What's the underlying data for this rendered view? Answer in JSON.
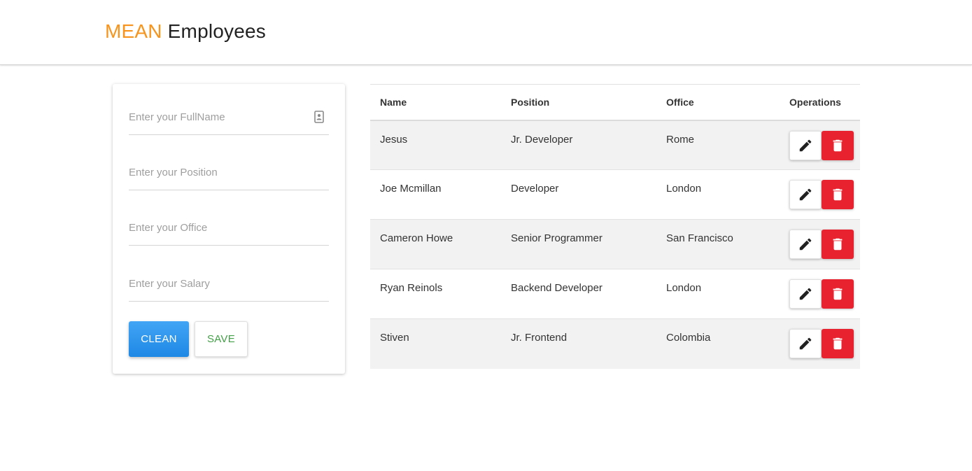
{
  "header": {
    "brand_accent": "MEAN",
    "brand_rest": " Employees"
  },
  "form": {
    "fullname": {
      "placeholder": "Enter your FullName",
      "value": "",
      "icon": "contact-card-icon"
    },
    "position": {
      "placeholder": "Enter your Position",
      "value": ""
    },
    "office": {
      "placeholder": "Enter your Office",
      "value": ""
    },
    "salary": {
      "placeholder": "Enter your Salary",
      "value": ""
    },
    "clean_label": "Clean",
    "save_label": "Save"
  },
  "table": {
    "columns": [
      "Name",
      "Position",
      "Office",
      "Operations"
    ],
    "rows": [
      {
        "name": "Jesus",
        "position": "Jr. Developer",
        "office": "Rome"
      },
      {
        "name": "Joe Mcmillan",
        "position": "Developer",
        "office": "London"
      },
      {
        "name": "Cameron Howe",
        "position": "Senior Programmer",
        "office": "San Francisco"
      },
      {
        "name": "Ryan Reinols",
        "position": "Backend Developer",
        "office": "London"
      },
      {
        "name": "Stiven",
        "position": "Jr. Frontend",
        "office": "Colombia"
      }
    ],
    "operations": {
      "edit_icon": "pencil-icon",
      "delete_icon": "trash-icon"
    }
  },
  "colors": {
    "brand_accent": "#f7941d",
    "clean_button": "#2196f3",
    "save_text": "#43a047",
    "delete_button": "#e8232f",
    "striped_row": "#f2f2f2"
  }
}
